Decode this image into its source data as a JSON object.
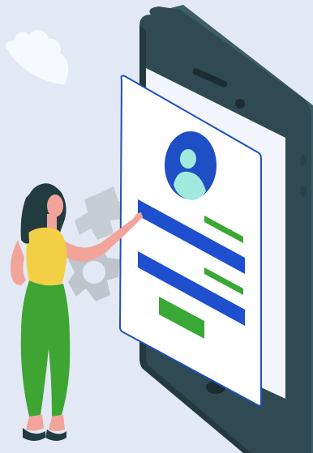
{
  "illustration": {
    "colors": {
      "background": "#e3e9f4",
      "cloud": "#f6f9fe",
      "phone_dark": "#24393f",
      "phone_body": "#2f4a52",
      "phone_side": "#3c5c66",
      "screen_back": "#f2f5fb",
      "card_border": "#1f4fbf",
      "card_fill": "#ffffff",
      "avatar_circle": "#1f4fc4",
      "avatar_person": "#9fe9df",
      "field_bar": "#1d4fcf",
      "green_accent": "#3aa835",
      "gear": "#c7cdd4",
      "hair": "#213b3f",
      "skin": "#f2a49a",
      "top": "#f2cf44",
      "pants": "#3ea532"
    },
    "icons": [
      "cloud-icon",
      "gear-icon",
      "user-avatar-icon"
    ]
  }
}
